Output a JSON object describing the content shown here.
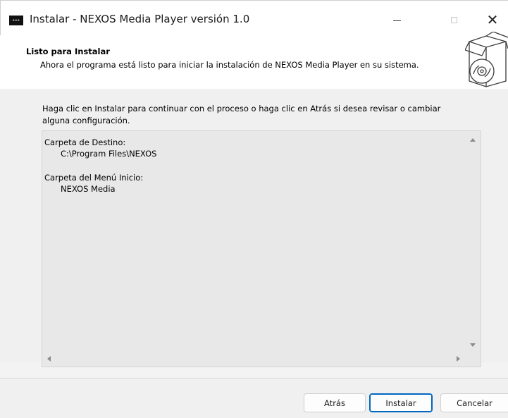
{
  "window": {
    "title": "Instalar - NEXOS Media Player versión 1.0",
    "icon": "app-icon",
    "controls": [
      "minimize-icon",
      "maximize-icon",
      "close-icon"
    ],
    "close_glyph": "✕"
  },
  "header": {
    "heading": "Listo para Instalar",
    "subheading": "Ahora el programa está listo para iniciar la instalación de NEXOS Media Player en su sistema.",
    "graphic": "installer-box-disc-icon"
  },
  "body": {
    "intro": "Haga clic en Instalar para continuar con el proceso o haga clic en Atrás si desea revisar o cambiar alguna configuración.",
    "summary": {
      "destination_label": "Carpeta de Destino:",
      "destination_value": "C:\\Program Files\\NEXOS",
      "start_menu_label": "Carpeta del Menú Inicio:",
      "start_menu_value": "NEXOS Media"
    }
  },
  "buttons": {
    "back": "Atrás",
    "install": "Instalar",
    "cancel": "Cancelar"
  },
  "colors": {
    "accent": "#0067c0",
    "header_bg": "#ffffff",
    "body_bg": "#f0f0f0",
    "memo_bg": "#e8e8e8"
  }
}
